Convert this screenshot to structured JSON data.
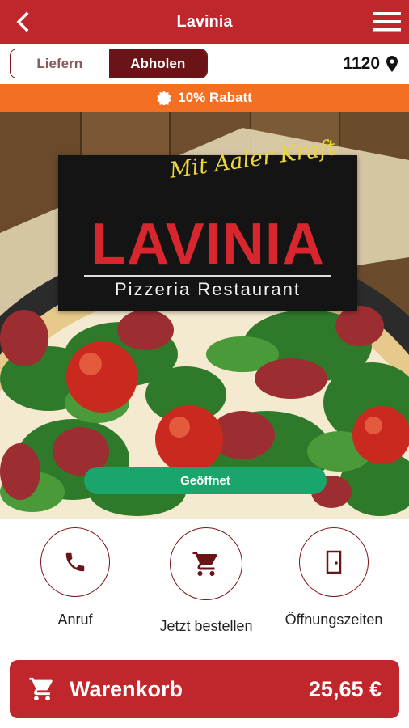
{
  "header": {
    "title": "Lavinia"
  },
  "mode_toggle": {
    "deliver_label": "Liefern",
    "pickup_label": "Abholen",
    "selected": "Abholen"
  },
  "location": {
    "zip": "1120"
  },
  "discount": {
    "label": "10% Rabatt"
  },
  "hero": {
    "slogan": "Mit Aaler Kraft",
    "brand": "LAVINIA",
    "subtitle": "Pizzeria Restaurant",
    "status_label": "Geöffnet"
  },
  "actions": [
    {
      "label": "Anruf",
      "icon": "phone-icon"
    },
    {
      "label": "Jetzt bestellen",
      "icon": "cart-icon"
    },
    {
      "label": "Öffnungszeiten",
      "icon": "door-icon"
    }
  ],
  "cart": {
    "label": "Warenkorb",
    "total": "25,65 €"
  },
  "colors": {
    "primary": "#c0272d",
    "dark_red": "#6b1417",
    "orange": "#f36f21",
    "green": "#1aa56d",
    "slogan": "#ecd63a"
  }
}
